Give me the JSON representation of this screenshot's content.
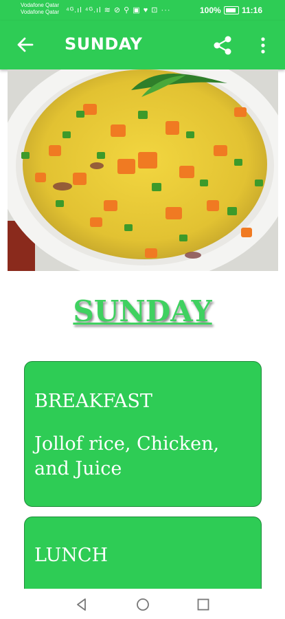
{
  "status_bar": {
    "carrier_line1": "Vodafone Qatar",
    "carrier_line2": "Vodafone Qatar",
    "icons_text": "⁴ᴳ.ıl ⁴ᴳ.ıl ≋ ⊘ ⚲ ▣ ♥ ⊡ ···",
    "battery_percent": "100%",
    "time": "11:16"
  },
  "app_bar": {
    "title": "SUNDAY"
  },
  "hero": {
    "image_subject": "vegetable-jollof-rice"
  },
  "content": {
    "day_heading": "SUNDAY",
    "meals": [
      {
        "title": "BREAKFAST",
        "description": "Jollof rice, Chicken, and Juice"
      },
      {
        "title": "LUNCH",
        "description": ""
      }
    ]
  },
  "colors": {
    "primary": "#2ecc55",
    "heading": "#3fd160"
  }
}
